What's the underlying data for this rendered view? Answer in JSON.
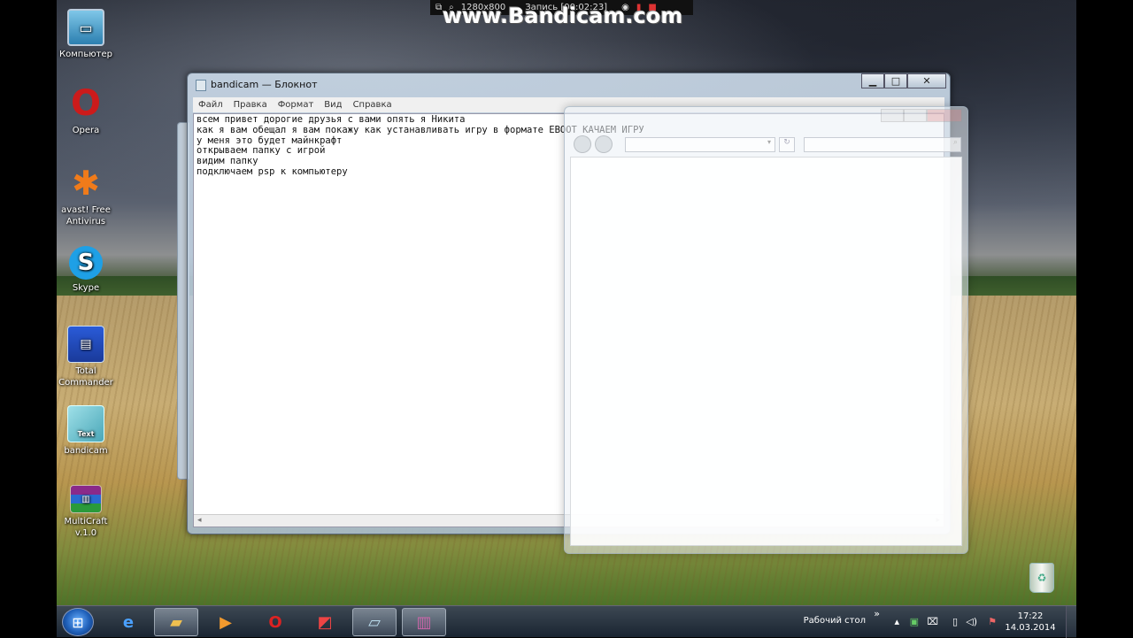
{
  "desktop": {
    "icons": [
      {
        "label": "Компьютер"
      },
      {
        "label": "Opera"
      },
      {
        "label": "avast! Free Antivirus"
      },
      {
        "label": "Skype"
      },
      {
        "label": "Total Commander"
      },
      {
        "label": "bandicam",
        "sub": "Text"
      },
      {
        "label": "MultiCraft v.1.0"
      }
    ]
  },
  "recorder": {
    "resolution": "1280x800",
    "status": "Запись [00:02:23]",
    "watermark": "www.Bandicam.com"
  },
  "notepad": {
    "title": "bandicam — Блокнот",
    "menu": [
      "Файл",
      "Правка",
      "Формат",
      "Вид",
      "Справка"
    ],
    "lines": [
      "всем привет дорогие друзья с вами опять я Никита",
      "как я вам обещал я вам покажу как устанавливать игру в формате EBOOT КАЧАЕМ ИГРУ",
      "у меня это будет майнкрафт",
      "открываем папку с игрой",
      "видим папку",
      "подключаем psp к компьютеру"
    ]
  },
  "taskbar": {
    "toolbar_label": "Рабочий стол",
    "time": "17:22",
    "date": "14.03.2014"
  },
  "colors": {
    "opera": "#cc1b1b",
    "skype": "#1ea0e6",
    "avast": "#f07b1a"
  }
}
